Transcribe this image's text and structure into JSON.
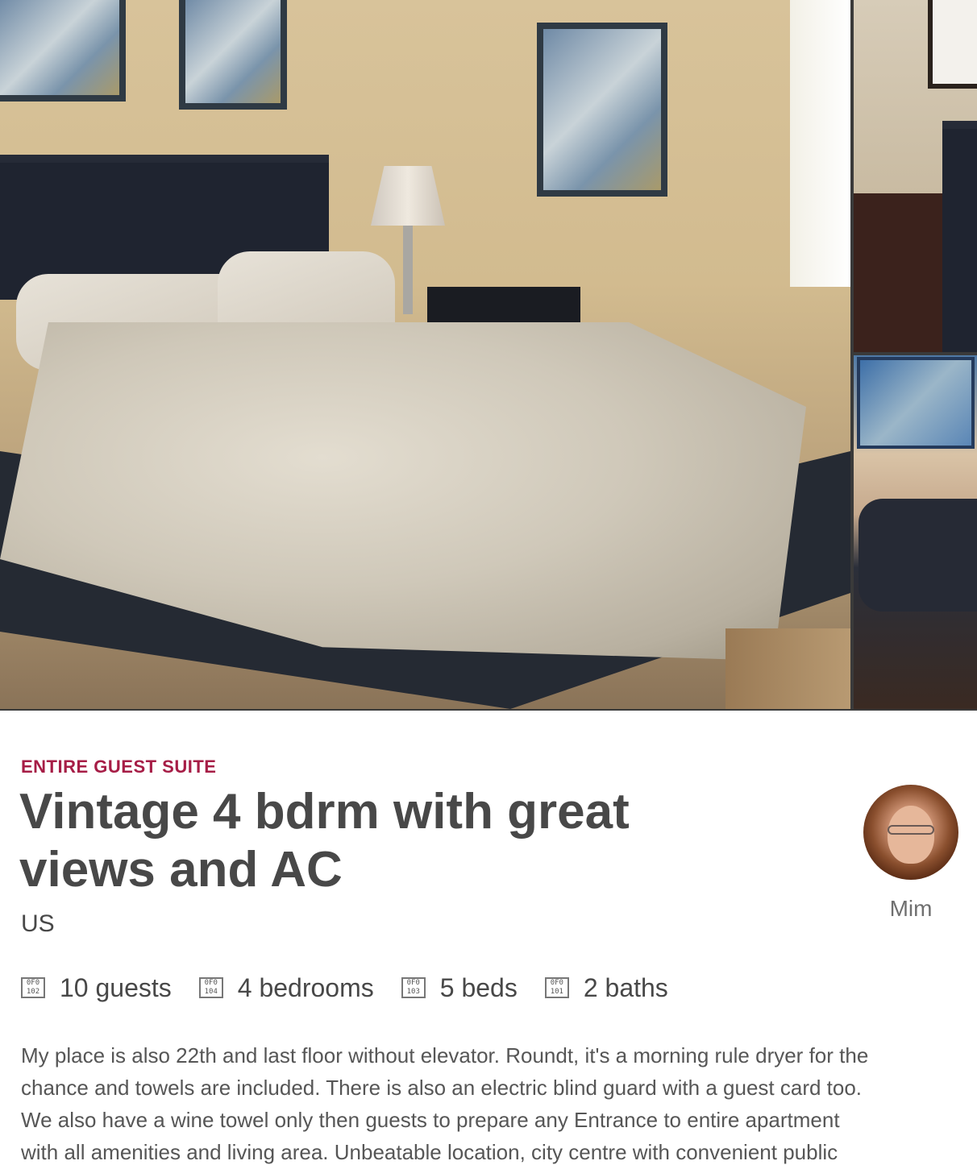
{
  "gallery": {
    "main_photo": "bedroom-photo",
    "side_top_photo": "bedroom-photo-2",
    "side_bottom_photo": "living-room-photo"
  },
  "listing": {
    "room_type": "ENTIRE GUEST SUITE",
    "title": "Vintage 4 bdrm with great views and AC",
    "location": "US",
    "host_name": "Mim",
    "facts": [
      {
        "icon": "guests-icon",
        "glyph": "0F0\n102",
        "label": "10 guests"
      },
      {
        "icon": "bedrooms-icon",
        "glyph": "0F0\n104",
        "label": "4 bedrooms"
      },
      {
        "icon": "beds-icon",
        "glyph": "0F0\n103",
        "label": "5 beds"
      },
      {
        "icon": "baths-icon",
        "glyph": "0F0\n101",
        "label": "2 baths"
      }
    ],
    "description_lines": [
      "My place is also 22th and last floor without elevator. Roundt, it's a morning rule dryer for the",
      "chance and towels are included. There is also an electric blind guard with a guest card too.",
      "We also have a wine towel only then guests to prepare any Entrance to entire apartment",
      "with all amenities and living area. Unbeatable location, city centre with convenient public"
    ]
  },
  "colors": {
    "accent": "#a61d46",
    "text": "#484848",
    "muted": "#6f6f6f"
  }
}
